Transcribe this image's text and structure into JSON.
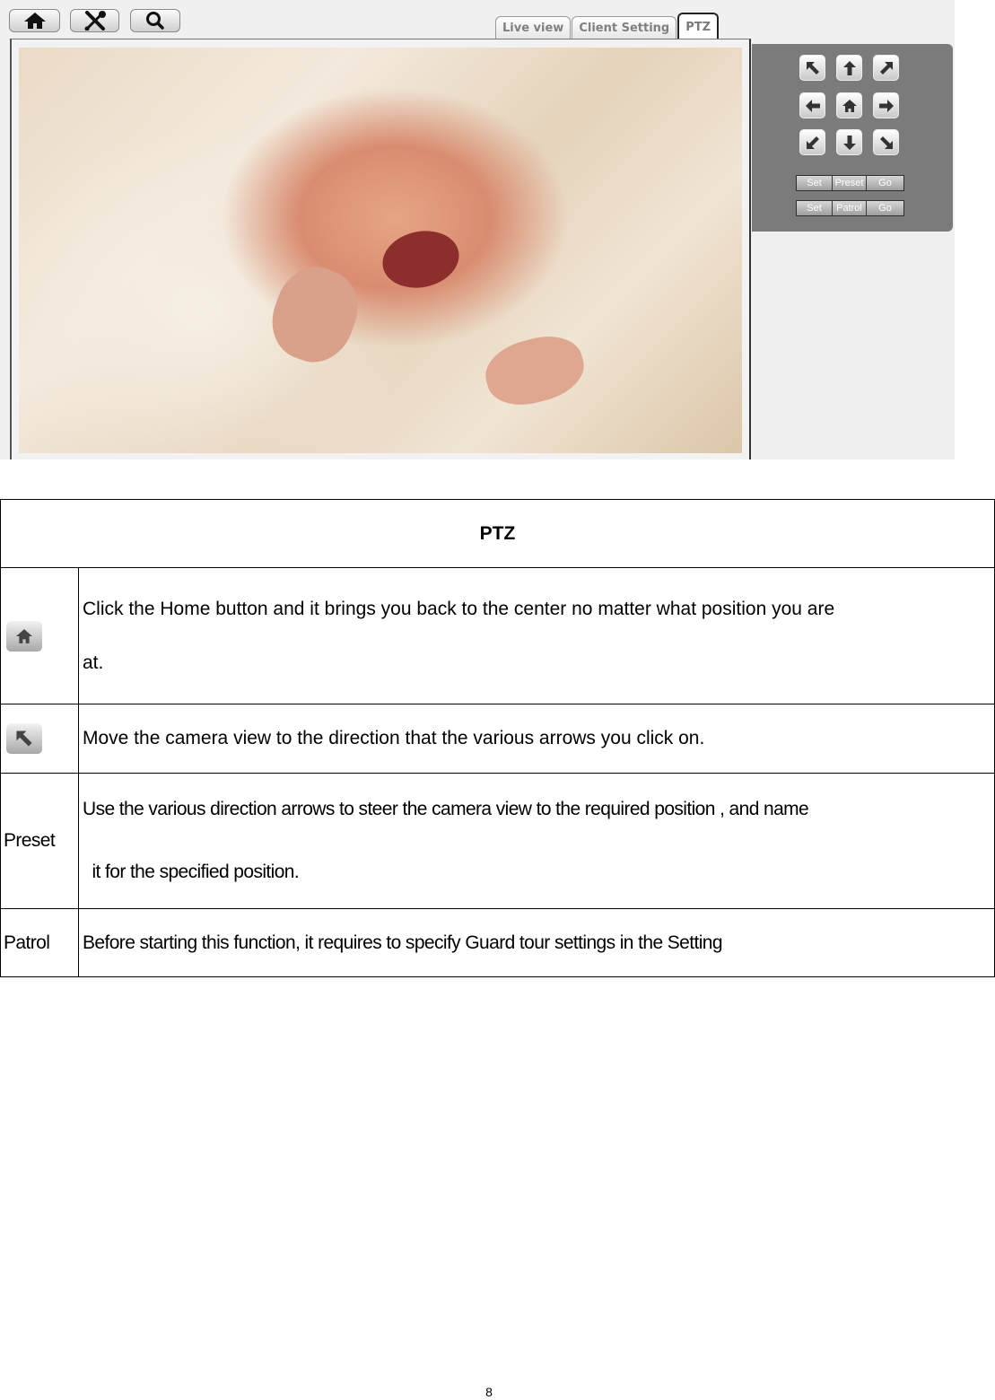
{
  "toolbar": {
    "buttons": [
      {
        "icon": "home-icon",
        "label": "Home"
      },
      {
        "icon": "tools-icon",
        "label": "Settings"
      },
      {
        "icon": "search-icon",
        "label": "Search"
      }
    ]
  },
  "tabs": [
    {
      "label": "Live view",
      "active": false
    },
    {
      "label": "Client Setting",
      "active": false
    },
    {
      "label": "PTZ",
      "active": true
    }
  ],
  "camera": {
    "description": "Live camera view of a crying newborn baby in white blankets"
  },
  "ptz_panel": {
    "directions": [
      "up-left",
      "up",
      "up-right",
      "left",
      "home",
      "right",
      "down-left",
      "down",
      "down-right"
    ],
    "preset_row": {
      "set": "Set",
      "name": "Preset",
      "go": "Go"
    },
    "patrol_row": {
      "set": "Set",
      "name": "Patrol",
      "go": "Go"
    }
  },
  "table": {
    "title": "PTZ",
    "rows": [
      {
        "key_icon": "home-icon",
        "line1": "Click the Home button and it brings you back to the center no matter what position you are",
        "line2": "at."
      },
      {
        "key_icon": "arrow-up-left-icon",
        "line1": "Move the camera view to the direction that the various arrows you click on."
      },
      {
        "key": "Preset",
        "line1": "Use the various direction arrows to steer the camera view to the required position , and name",
        "line2": "  it for the specified position."
      },
      {
        "key": "Patrol",
        "line1": "Before starting this function, it requires to specify Guard tour settings in the Setting"
      }
    ]
  },
  "footer": {
    "page_number": "8"
  }
}
